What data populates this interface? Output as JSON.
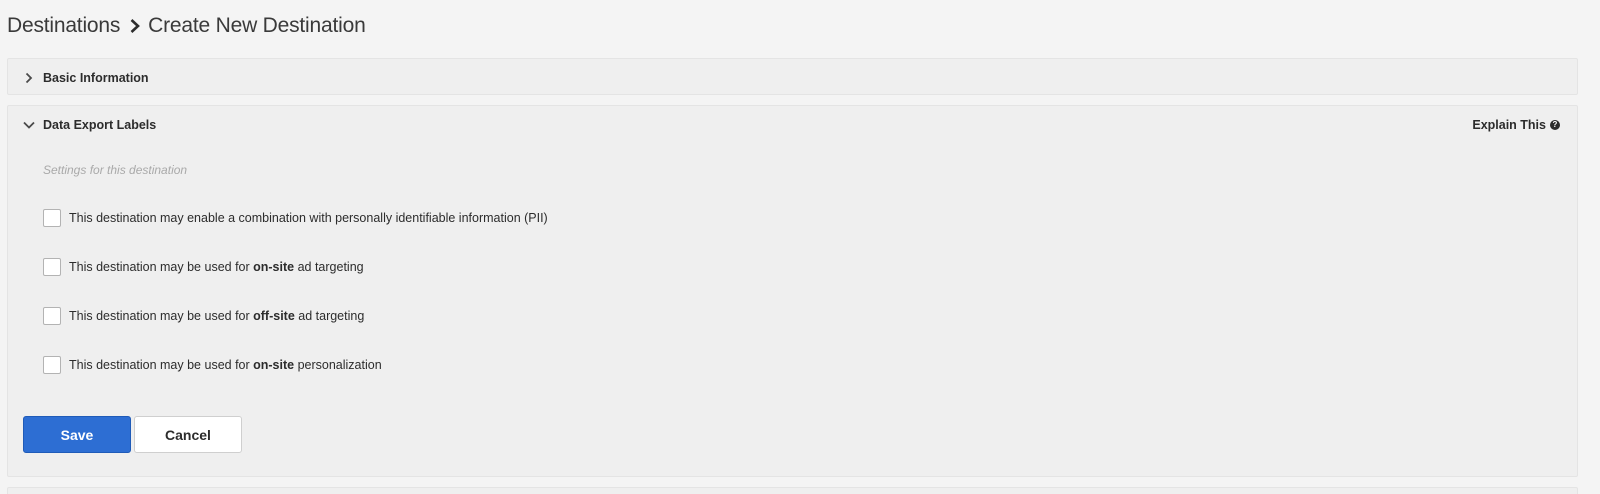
{
  "breadcrumb": {
    "parent": "Destinations",
    "current": "Create New Destination"
  },
  "sections": {
    "basic": {
      "title": "Basic Information",
      "expanded": false
    },
    "export": {
      "title": "Data Export Labels",
      "expanded": true,
      "explain_label": "Explain This",
      "explain_icon": "question-circle-icon",
      "note": "Settings for this destination",
      "options": [
        {
          "before": "This destination may enable a combination with personally identifiable information (PII)",
          "bold": "",
          "after": "",
          "checked": false
        },
        {
          "before": "This destination may be used for ",
          "bold": "on-site",
          "after": " ad targeting",
          "checked": false
        },
        {
          "before": "This destination may be used for ",
          "bold": "off-site",
          "after": " ad targeting",
          "checked": false
        },
        {
          "before": "This destination may be used for ",
          "bold": "on-site",
          "after": " personalization",
          "checked": false
        }
      ]
    }
  },
  "actions": {
    "save_label": "Save",
    "cancel_label": "Cancel"
  },
  "colors": {
    "primary": "#2d6ed3",
    "background": "#f4f4f4",
    "panel": "#efefef"
  }
}
